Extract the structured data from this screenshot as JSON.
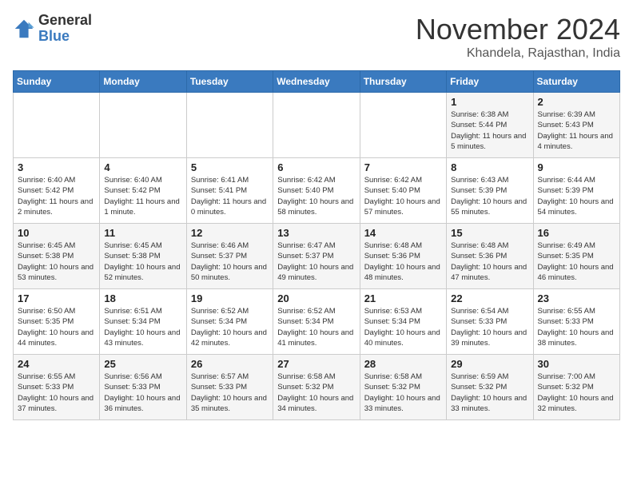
{
  "logo": {
    "general": "General",
    "blue": "Blue"
  },
  "title": "November 2024",
  "location": "Khandela, Rajasthan, India",
  "weekdays": [
    "Sunday",
    "Monday",
    "Tuesday",
    "Wednesday",
    "Thursday",
    "Friday",
    "Saturday"
  ],
  "weeks": [
    [
      null,
      null,
      null,
      null,
      null,
      {
        "day": "1",
        "sunrise": "6:38 AM",
        "sunset": "5:44 PM",
        "daylight": "11 hours and 5 minutes."
      },
      {
        "day": "2",
        "sunrise": "6:39 AM",
        "sunset": "5:43 PM",
        "daylight": "11 hours and 4 minutes."
      }
    ],
    [
      {
        "day": "3",
        "sunrise": "6:40 AM",
        "sunset": "5:42 PM",
        "daylight": "11 hours and 2 minutes."
      },
      {
        "day": "4",
        "sunrise": "6:40 AM",
        "sunset": "5:42 PM",
        "daylight": "11 hours and 1 minute."
      },
      {
        "day": "5",
        "sunrise": "6:41 AM",
        "sunset": "5:41 PM",
        "daylight": "11 hours and 0 minutes."
      },
      {
        "day": "6",
        "sunrise": "6:42 AM",
        "sunset": "5:40 PM",
        "daylight": "10 hours and 58 minutes."
      },
      {
        "day": "7",
        "sunrise": "6:42 AM",
        "sunset": "5:40 PM",
        "daylight": "10 hours and 57 minutes."
      },
      {
        "day": "8",
        "sunrise": "6:43 AM",
        "sunset": "5:39 PM",
        "daylight": "10 hours and 55 minutes."
      },
      {
        "day": "9",
        "sunrise": "6:44 AM",
        "sunset": "5:39 PM",
        "daylight": "10 hours and 54 minutes."
      }
    ],
    [
      {
        "day": "10",
        "sunrise": "6:45 AM",
        "sunset": "5:38 PM",
        "daylight": "10 hours and 53 minutes."
      },
      {
        "day": "11",
        "sunrise": "6:45 AM",
        "sunset": "5:38 PM",
        "daylight": "10 hours and 52 minutes."
      },
      {
        "day": "12",
        "sunrise": "6:46 AM",
        "sunset": "5:37 PM",
        "daylight": "10 hours and 50 minutes."
      },
      {
        "day": "13",
        "sunrise": "6:47 AM",
        "sunset": "5:37 PM",
        "daylight": "10 hours and 49 minutes."
      },
      {
        "day": "14",
        "sunrise": "6:48 AM",
        "sunset": "5:36 PM",
        "daylight": "10 hours and 48 minutes."
      },
      {
        "day": "15",
        "sunrise": "6:48 AM",
        "sunset": "5:36 PM",
        "daylight": "10 hours and 47 minutes."
      },
      {
        "day": "16",
        "sunrise": "6:49 AM",
        "sunset": "5:35 PM",
        "daylight": "10 hours and 46 minutes."
      }
    ],
    [
      {
        "day": "17",
        "sunrise": "6:50 AM",
        "sunset": "5:35 PM",
        "daylight": "10 hours and 44 minutes."
      },
      {
        "day": "18",
        "sunrise": "6:51 AM",
        "sunset": "5:34 PM",
        "daylight": "10 hours and 43 minutes."
      },
      {
        "day": "19",
        "sunrise": "6:52 AM",
        "sunset": "5:34 PM",
        "daylight": "10 hours and 42 minutes."
      },
      {
        "day": "20",
        "sunrise": "6:52 AM",
        "sunset": "5:34 PM",
        "daylight": "10 hours and 41 minutes."
      },
      {
        "day": "21",
        "sunrise": "6:53 AM",
        "sunset": "5:34 PM",
        "daylight": "10 hours and 40 minutes."
      },
      {
        "day": "22",
        "sunrise": "6:54 AM",
        "sunset": "5:33 PM",
        "daylight": "10 hours and 39 minutes."
      },
      {
        "day": "23",
        "sunrise": "6:55 AM",
        "sunset": "5:33 PM",
        "daylight": "10 hours and 38 minutes."
      }
    ],
    [
      {
        "day": "24",
        "sunrise": "6:55 AM",
        "sunset": "5:33 PM",
        "daylight": "10 hours and 37 minutes."
      },
      {
        "day": "25",
        "sunrise": "6:56 AM",
        "sunset": "5:33 PM",
        "daylight": "10 hours and 36 minutes."
      },
      {
        "day": "26",
        "sunrise": "6:57 AM",
        "sunset": "5:33 PM",
        "daylight": "10 hours and 35 minutes."
      },
      {
        "day": "27",
        "sunrise": "6:58 AM",
        "sunset": "5:32 PM",
        "daylight": "10 hours and 34 minutes."
      },
      {
        "day": "28",
        "sunrise": "6:58 AM",
        "sunset": "5:32 PM",
        "daylight": "10 hours and 33 minutes."
      },
      {
        "day": "29",
        "sunrise": "6:59 AM",
        "sunset": "5:32 PM",
        "daylight": "10 hours and 33 minutes."
      },
      {
        "day": "30",
        "sunrise": "7:00 AM",
        "sunset": "5:32 PM",
        "daylight": "10 hours and 32 minutes."
      }
    ]
  ]
}
